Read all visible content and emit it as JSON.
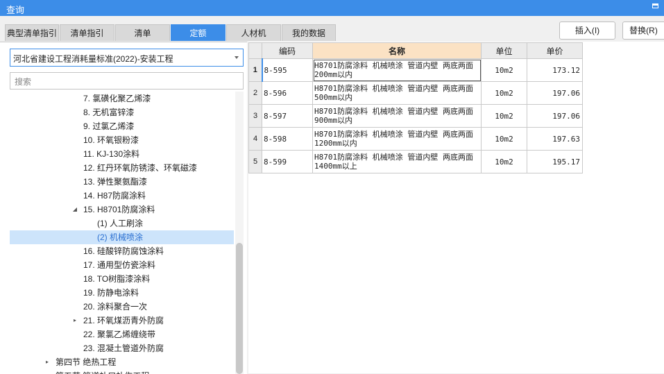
{
  "window": {
    "title": "查询"
  },
  "tabs": [
    "典型清单指引",
    "清单指引",
    "清单",
    "定额",
    "人材机",
    "我的数据"
  ],
  "active_tab": "定额",
  "actions": {
    "insert_label": "插入(I)",
    "replace_label": "替换(R)"
  },
  "left": {
    "standard_select": "河北省建设工程消耗量标准(2022)-安装工程",
    "search_placeholder": "搜索",
    "tree": [
      {
        "label": "7. 氯磺化聚乙烯漆",
        "toggle": ""
      },
      {
        "label": "8. 无机富锌漆",
        "toggle": ""
      },
      {
        "label": "9. 过氯乙烯漆",
        "toggle": ""
      },
      {
        "label": "10. 环氧银粉漆",
        "toggle": ""
      },
      {
        "label": "11. KJ-130涂料",
        "toggle": ""
      },
      {
        "label": "12. 红丹环氧防锈漆、环氧磁漆",
        "toggle": ""
      },
      {
        "label": "13. 弹性聚氨酯漆",
        "toggle": ""
      },
      {
        "label": "14. H87防腐涂料",
        "toggle": ""
      },
      {
        "label": "15. H8701防腐涂料",
        "toggle": "◢"
      },
      {
        "label": "(1) 人工刷涂",
        "toggle": ""
      },
      {
        "label": "(2) 机械喷涂",
        "toggle": ""
      },
      {
        "label": "16. 硅酸锌防腐蚀涂料",
        "toggle": ""
      },
      {
        "label": "17. 通用型仿瓷涂料",
        "toggle": ""
      },
      {
        "label": "18. TO树脂漆涂料",
        "toggle": ""
      },
      {
        "label": "19. 防静电涂料",
        "toggle": ""
      },
      {
        "label": "20. 涂料聚合一次",
        "toggle": ""
      },
      {
        "label": "21. 环氧煤沥青外防腐",
        "toggle": "▸"
      },
      {
        "label": "22. 聚氯乙烯缠绕带",
        "toggle": ""
      },
      {
        "label": "23. 混凝土管道外防腐",
        "toggle": ""
      },
      {
        "label": "第四节 绝热工程",
        "toggle": "▸"
      },
      {
        "label": "第五节 管道补口补伤工程",
        "toggle": ""
      }
    ]
  },
  "table": {
    "headers": [
      "编码",
      "名称",
      "单位",
      "单价"
    ],
    "rows": [
      {
        "no": "1",
        "code": "8-595",
        "name": "H8701防腐涂料 机械喷涂 管道内壁 两底两面 200mm以内",
        "unit": "10m2",
        "price": "173.12"
      },
      {
        "no": "2",
        "code": "8-596",
        "name": "H8701防腐涂料 机械喷涂 管道内壁 两底两面 500mm以内",
        "unit": "10m2",
        "price": "197.06"
      },
      {
        "no": "3",
        "code": "8-597",
        "name": "H8701防腐涂料 机械喷涂 管道内壁 两底两面 900mm以内",
        "unit": "10m2",
        "price": "197.06"
      },
      {
        "no": "4",
        "code": "8-598",
        "name": "H8701防腐涂料 机械喷涂 管道内壁 两底两面 1200mm以内",
        "unit": "10m2",
        "price": "197.63"
      },
      {
        "no": "5",
        "code": "8-599",
        "name": "H8701防腐涂料 机械喷涂 管道内壁 两底两面 1400mm以上",
        "unit": "10m2",
        "price": "195.17"
      }
    ]
  },
  "colors": {
    "accent": "#3c8de8",
    "header_highlight": "#fbe2c4",
    "selection": "#cde4fb"
  }
}
